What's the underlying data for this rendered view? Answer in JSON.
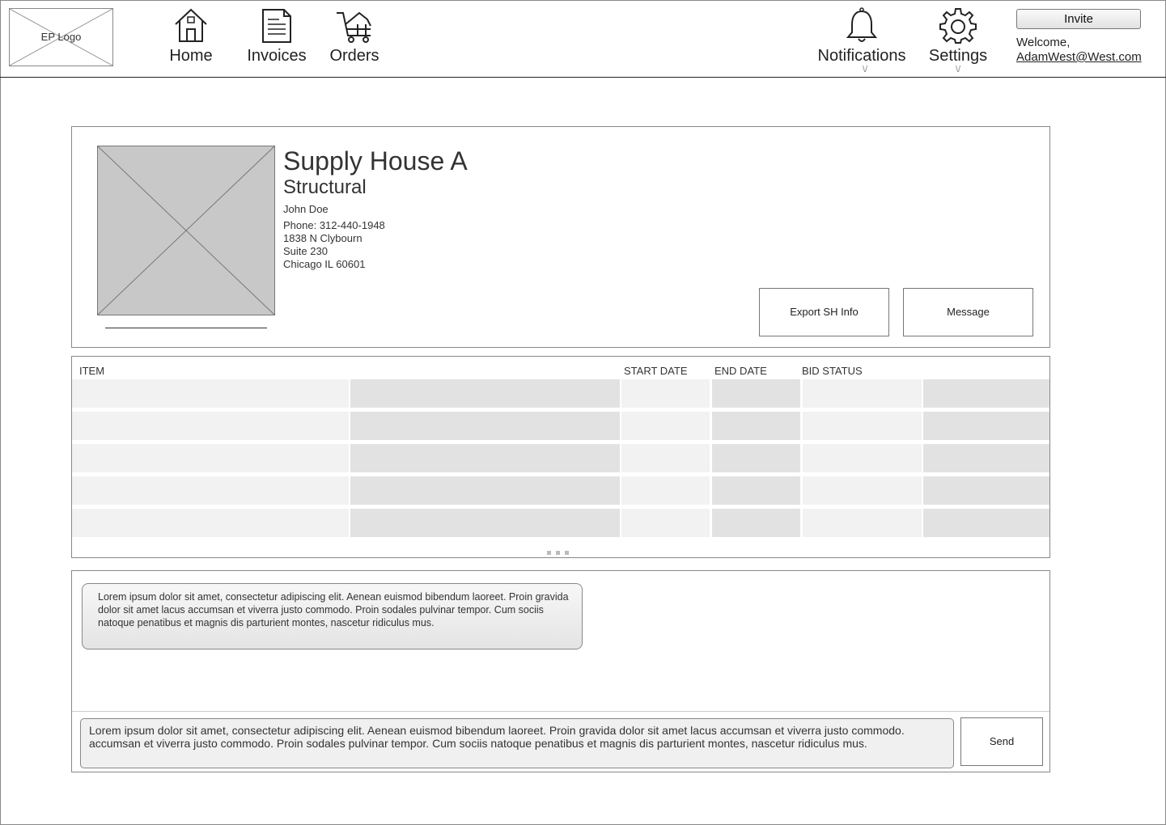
{
  "header": {
    "logo_text": "EP Logo",
    "nav": [
      {
        "label": "Home",
        "icon": "home-icon"
      },
      {
        "label": "Invoices",
        "icon": "invoice-icon"
      },
      {
        "label": "Orders",
        "icon": "cart-icon"
      }
    ],
    "notifications_label": "Notifications",
    "settings_label": "Settings",
    "dropdown_glyph": "\\/",
    "invite_label": "Invite",
    "welcome_text": "Welcome,",
    "user_email": "AdamWest@West.com"
  },
  "profile": {
    "name": "Supply House A",
    "category": "Structural",
    "contact": "John Doe",
    "phone": "Phone: 312-440-1948",
    "address1": "1838 N Clybourn",
    "address2": "Suite 230",
    "address3": "Chicago IL 60601",
    "export_label": "Export SH Info",
    "message_label": "Message"
  },
  "table": {
    "columns": [
      "ITEM",
      "START DATE",
      "END DATE",
      "BID STATUS"
    ],
    "row_count": 5
  },
  "chat": {
    "messages": [
      "Lorem ipsum dolor sit amet, consectetur adipiscing elit. Aenean euismod bibendum laoreet. Proin gravida dolor sit amet lacus accumsan et viverra justo commodo. Proin sodales pulvinar tempor. Cum sociis natoque penatibus et magnis dis parturient montes, nascetur ridiculus mus."
    ],
    "compose_text": "Lorem ipsum dolor sit amet, consectetur adipiscing elit. Aenean euismod bibendum laoreet. Proin gravida dolor sit amet lacus accumsan et viverra justo commodo.  accumsan et viverra justo commodo. Proin sodales pulvinar tempor. Cum sociis natoque penatibus et magnis dis parturient montes, nascetur ridiculus mus.",
    "send_label": "Send"
  }
}
